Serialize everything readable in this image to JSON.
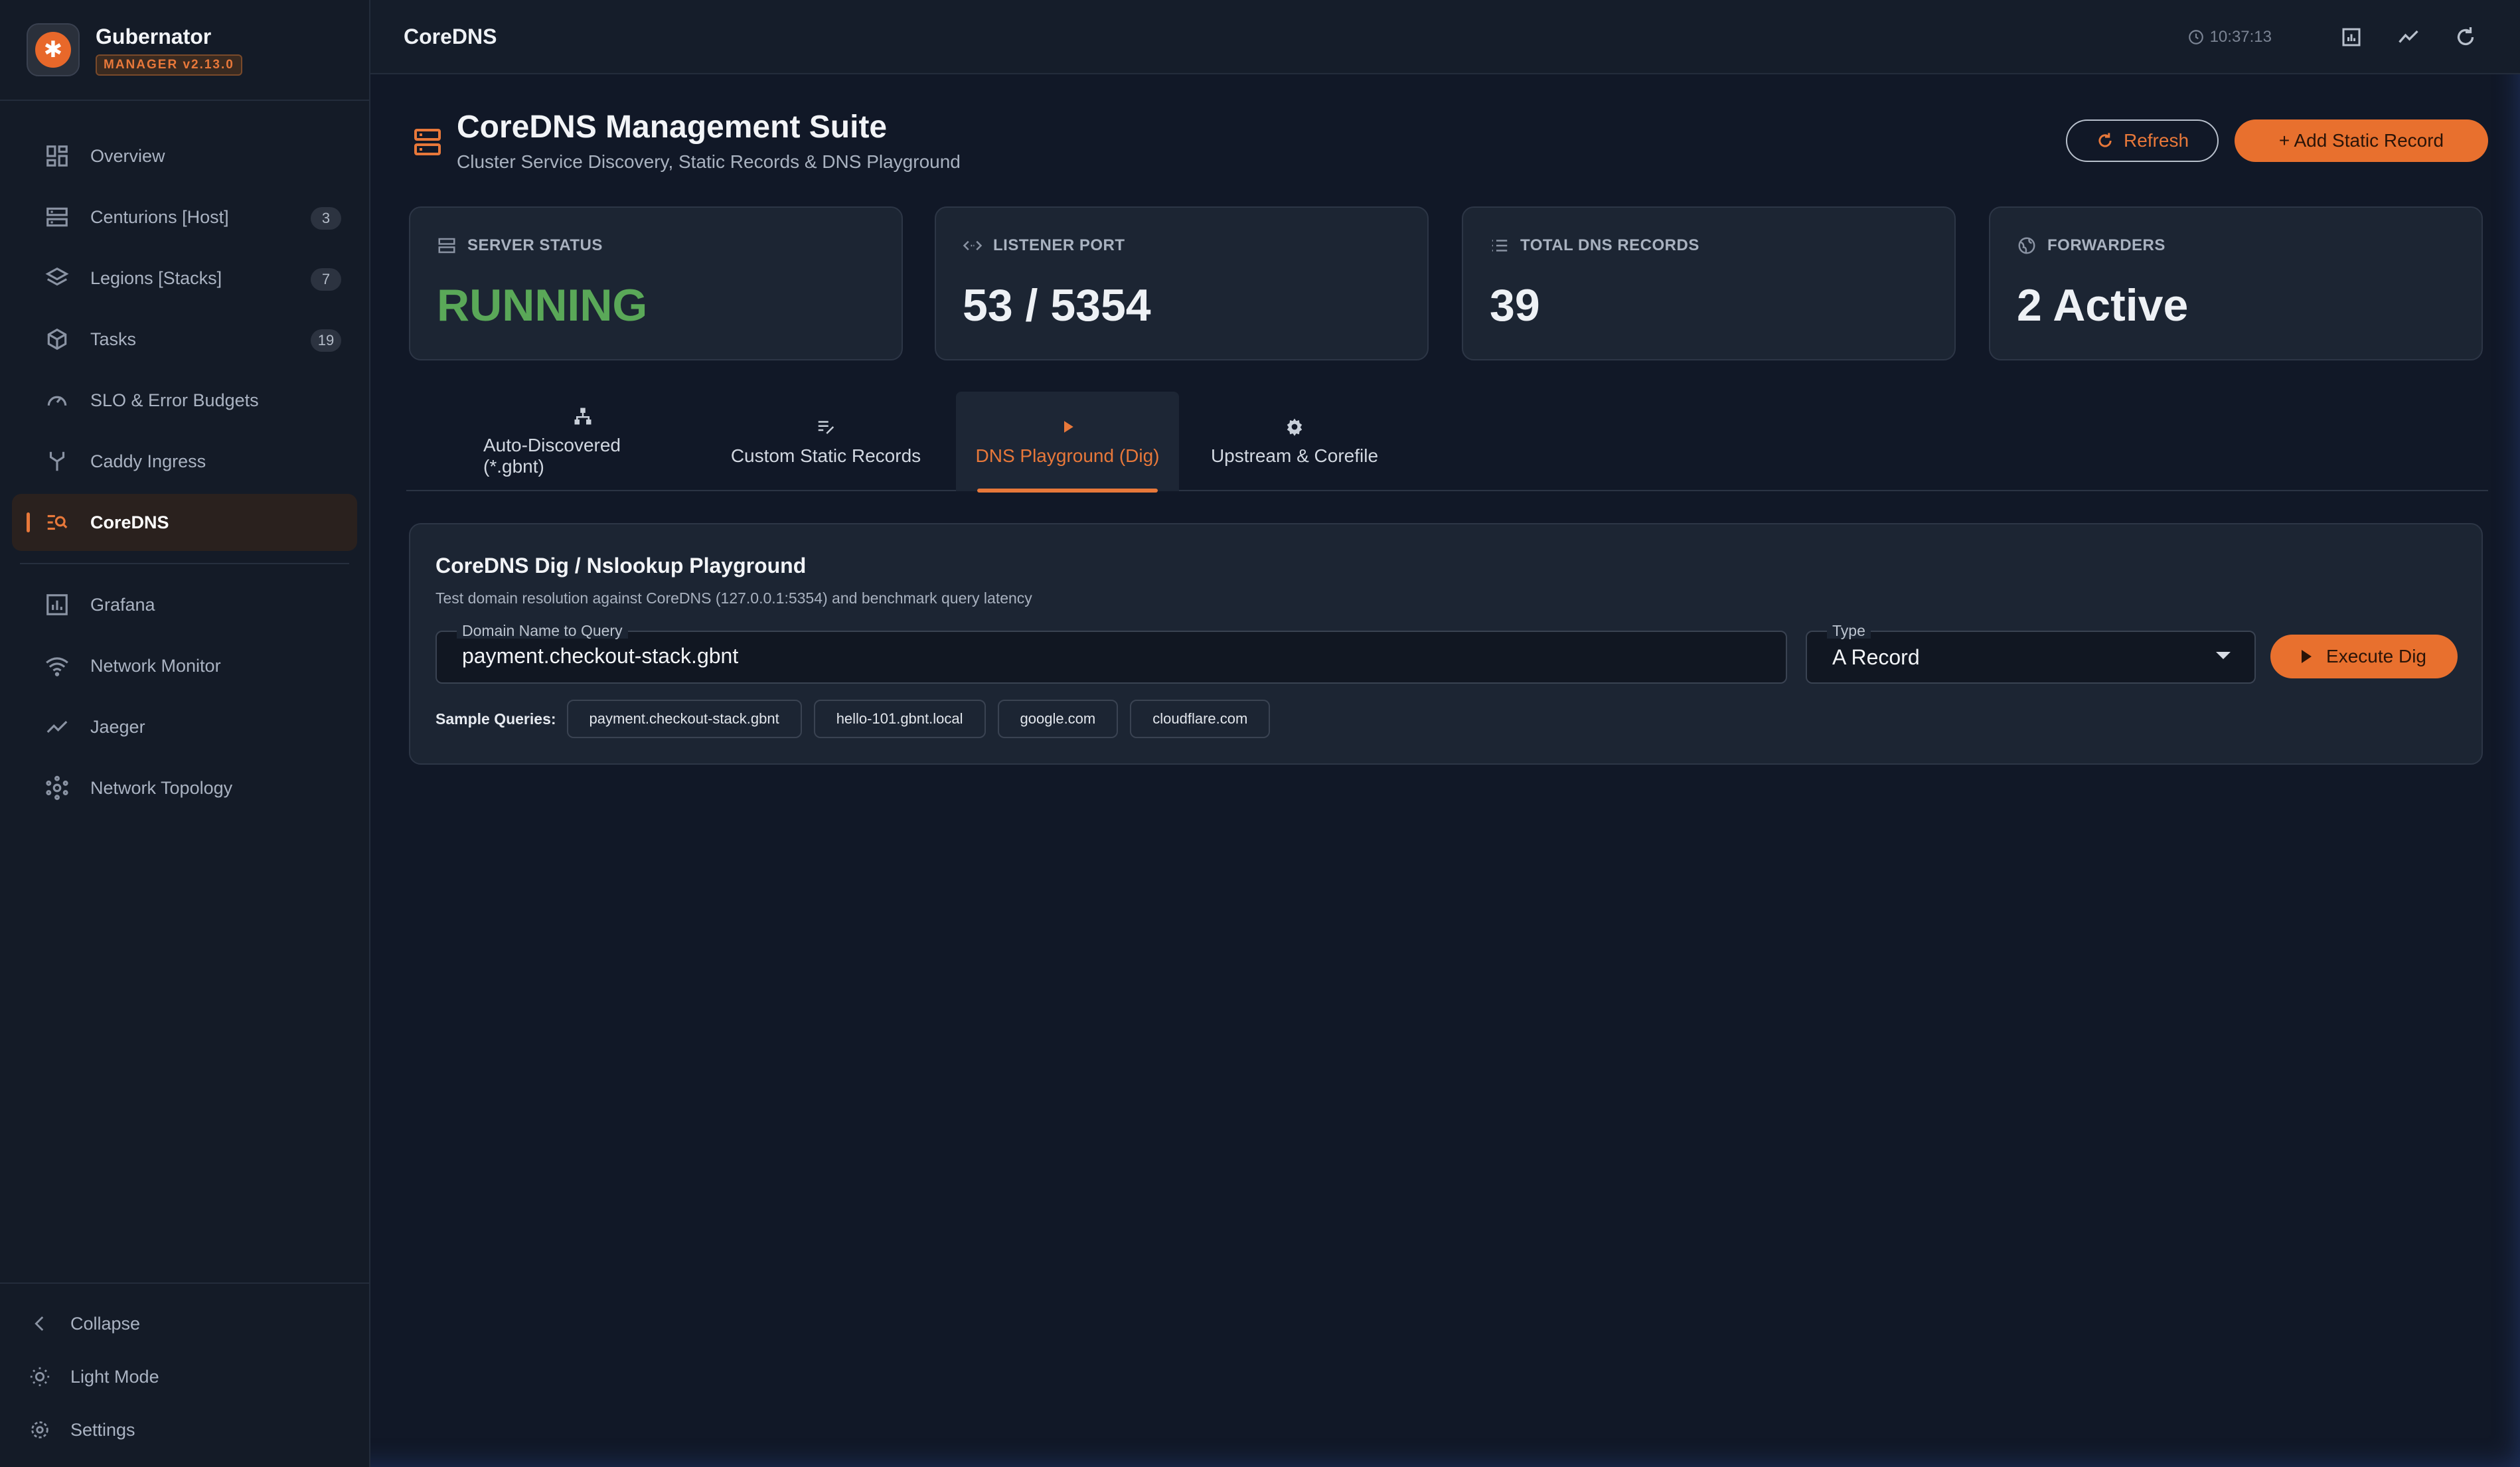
{
  "brand": {
    "name": "Gubernator",
    "version": "MANAGER v2.13.0"
  },
  "sidebar": {
    "items": [
      {
        "label": "Overview",
        "icon": "dashboard-icon",
        "badge": null,
        "active": false
      },
      {
        "label": "Centurions [Host]",
        "icon": "server-icon",
        "badge": "3",
        "active": false
      },
      {
        "label": "Legions [Stacks]",
        "icon": "layers-icon",
        "badge": "7",
        "active": false
      },
      {
        "label": "Tasks",
        "icon": "cube-icon",
        "badge": "19",
        "active": false
      },
      {
        "label": "SLO & Error Budgets",
        "icon": "gauge-icon",
        "badge": null,
        "active": false
      },
      {
        "label": "Caddy Ingress",
        "icon": "fork-icon",
        "badge": null,
        "active": false
      },
      {
        "label": "CoreDNS",
        "icon": "dns-search-icon",
        "badge": null,
        "active": true
      }
    ],
    "secondary": [
      {
        "label": "Grafana",
        "icon": "chart-icon"
      },
      {
        "label": "Network Monitor",
        "icon": "wifi-icon"
      },
      {
        "label": "Jaeger",
        "icon": "trend-icon"
      },
      {
        "label": "Network Topology",
        "icon": "hub-icon"
      }
    ],
    "bottom": {
      "collapse": "Collapse",
      "theme": "Light Mode",
      "settings": "Settings"
    }
  },
  "topbar": {
    "title": "CoreDNS",
    "time": "10:37:13"
  },
  "header": {
    "title": "CoreDNS Management Suite",
    "subtitle": "Cluster Service Discovery, Static Records & DNS Playground",
    "refresh_label": "Refresh",
    "add_label": "+ Add Static Record"
  },
  "stats": [
    {
      "label": "SERVER STATUS",
      "value": "RUNNING",
      "icon": "server-icon",
      "color": "#5aa858"
    },
    {
      "label": "LISTENER PORT",
      "value": "53 / 5354",
      "icon": "code-icon",
      "color": "#eef1f5"
    },
    {
      "label": "TOTAL DNS RECORDS",
      "value": "39",
      "icon": "list-icon",
      "color": "#eef1f5"
    },
    {
      "label": "FORWARDERS",
      "value": "2 Active",
      "icon": "globe-icon",
      "color": "#eef1f5"
    }
  ],
  "tabs": [
    {
      "label": "Auto-Discovered (*.gbnt)",
      "icon": "sitemap-icon",
      "active": false
    },
    {
      "label": "Custom Static Records",
      "icon": "edit-list-icon",
      "active": false
    },
    {
      "label": "DNS Playground (Dig)",
      "icon": "play-icon",
      "active": true
    },
    {
      "label": "Upstream & Corefile",
      "icon": "gear-icon",
      "active": false
    }
  ],
  "playground": {
    "title": "CoreDNS Dig / Nslookup Playground",
    "subtitle": "Test domain resolution against CoreDNS (127.0.0.1:5354) and benchmark query latency",
    "domain_label": "Domain Name to Query",
    "domain_value": "payment.checkout-stack.gbnt",
    "type_label": "Type",
    "type_value": "A Record",
    "execute_label": "Execute Dig",
    "samples_label": "Sample Queries:",
    "samples": [
      "payment.checkout-stack.gbnt",
      "hello-101.gbnt.local",
      "google.com",
      "cloudflare.com"
    ]
  },
  "colors": {
    "accent": "#e8783a",
    "running": "#5aa858",
    "background": "#111827"
  }
}
